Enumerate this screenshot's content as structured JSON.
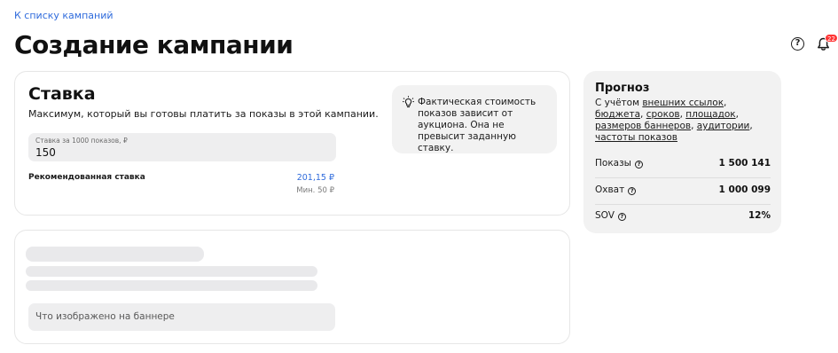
{
  "header": {
    "back_link": "К списку кампаний",
    "title": "Создание кампании",
    "help_icon": "question-circle-icon",
    "notifications_icon": "bell-icon",
    "notifications_count": "22"
  },
  "bid_card": {
    "title": "Ставка",
    "subtitle": "Максимум, который вы готовы платить за показы в этой кампании.",
    "field": {
      "label": "Ставка за 1000 показов, ₽",
      "value": "150"
    },
    "recommended": {
      "label": "Рекомендованная ставка",
      "value": "201,15 ₽",
      "min": "Мин. 50 ₽"
    },
    "hint": {
      "icon": "lightbulb-icon",
      "text": "Фактическая стоимость показов зависит от аукциона. Она не превысит заданную ставку."
    }
  },
  "banner_card": {
    "field_placeholder": "Что изображено на баннере"
  },
  "forecast": {
    "title": "Прогноз",
    "prefix": "С учётом ",
    "links": [
      "внешних ссылок",
      "бюджета",
      "сроков",
      "площадок",
      "размеров баннеров",
      "аудитории",
      "частоты показов"
    ],
    "rows": [
      {
        "label": "Показы",
        "value": "1 500 141"
      },
      {
        "label": "Охват",
        "value": "1 000 099"
      },
      {
        "label": "SOV",
        "value": "12%"
      }
    ]
  },
  "colors": {
    "link": "#2f6bdc",
    "badge": "#ff3333",
    "panel": "#f2f2f2",
    "skeleton": "#e9e9eb"
  }
}
